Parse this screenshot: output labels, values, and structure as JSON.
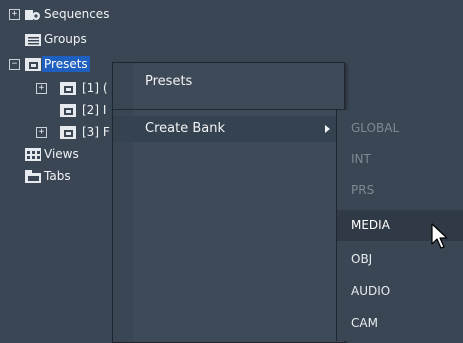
{
  "tree": {
    "items": [
      {
        "label": "Sequences",
        "expander": "+"
      },
      {
        "label": "Groups"
      },
      {
        "label": "Presets",
        "expander": "−"
      },
      {
        "label": "[1] (",
        "expander": "+"
      },
      {
        "label": "[2] I"
      },
      {
        "label": "[3] F",
        "expander": "+"
      },
      {
        "label": "Views"
      },
      {
        "label": "Tabs"
      }
    ]
  },
  "context_menu": {
    "title": "Presets",
    "items": [
      {
        "label": "Create Bank"
      }
    ]
  },
  "submenu": {
    "items": [
      {
        "label": "GLOBAL",
        "state": "disabled"
      },
      {
        "label": "INT",
        "state": "disabled"
      },
      {
        "label": "PRS",
        "state": "disabled"
      },
      {
        "label": "MEDIA",
        "state": "hover"
      },
      {
        "label": "OBJ",
        "state": "enabled"
      },
      {
        "label": "AUDIO",
        "state": "enabled"
      },
      {
        "label": "CAM",
        "state": "enabled"
      }
    ]
  },
  "colors": {
    "background": "#3a4654",
    "selection": "#1f5fbf",
    "disabled_text": "#7f8995"
  },
  "icons": [
    "sequences-icon",
    "folder-icon",
    "preset-folder-icon",
    "views-grid-icon",
    "tabs-icon",
    "submenu-arrow-icon",
    "mouse-pointer-icon"
  ]
}
